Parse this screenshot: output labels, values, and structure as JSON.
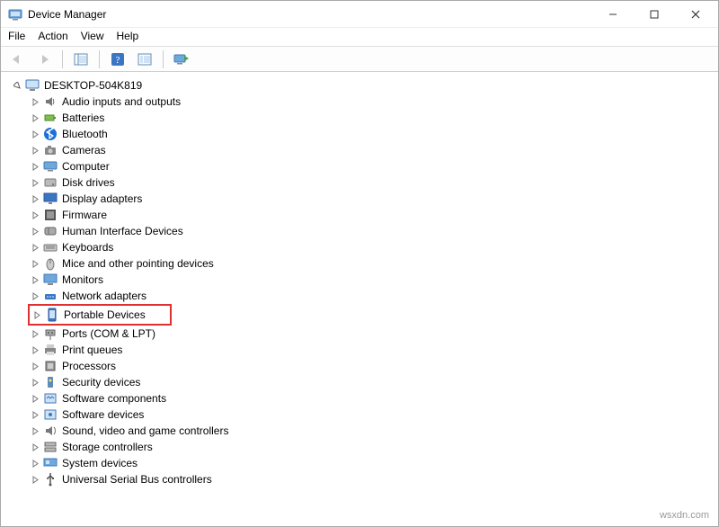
{
  "window": {
    "title": "Device Manager"
  },
  "menu": {
    "file": "File",
    "action": "Action",
    "view": "View",
    "help": "Help"
  },
  "tree": {
    "root": "DESKTOP-504K819",
    "items": [
      {
        "label": "Audio inputs and outputs",
        "icon": "audio"
      },
      {
        "label": "Batteries",
        "icon": "battery"
      },
      {
        "label": "Bluetooth",
        "icon": "bluetooth"
      },
      {
        "label": "Cameras",
        "icon": "camera"
      },
      {
        "label": "Computer",
        "icon": "computer"
      },
      {
        "label": "Disk drives",
        "icon": "disk"
      },
      {
        "label": "Display adapters",
        "icon": "display"
      },
      {
        "label": "Firmware",
        "icon": "firmware"
      },
      {
        "label": "Human Interface Devices",
        "icon": "hid"
      },
      {
        "label": "Keyboards",
        "icon": "keyboard"
      },
      {
        "label": "Mice and other pointing devices",
        "icon": "mouse"
      },
      {
        "label": "Monitors",
        "icon": "monitor"
      },
      {
        "label": "Network adapters",
        "icon": "network"
      },
      {
        "label": "Portable Devices",
        "icon": "portable",
        "highlighted": true
      },
      {
        "label": "Ports (COM & LPT)",
        "icon": "port"
      },
      {
        "label": "Print queues",
        "icon": "printer"
      },
      {
        "label": "Processors",
        "icon": "cpu"
      },
      {
        "label": "Security devices",
        "icon": "security"
      },
      {
        "label": "Software components",
        "icon": "swcomp"
      },
      {
        "label": "Software devices",
        "icon": "swdev"
      },
      {
        "label": "Sound, video and game controllers",
        "icon": "sound"
      },
      {
        "label": "Storage controllers",
        "icon": "storage"
      },
      {
        "label": "System devices",
        "icon": "system"
      },
      {
        "label": "Universal Serial Bus controllers",
        "icon": "usb"
      }
    ]
  },
  "watermark": "wsxdn.com"
}
